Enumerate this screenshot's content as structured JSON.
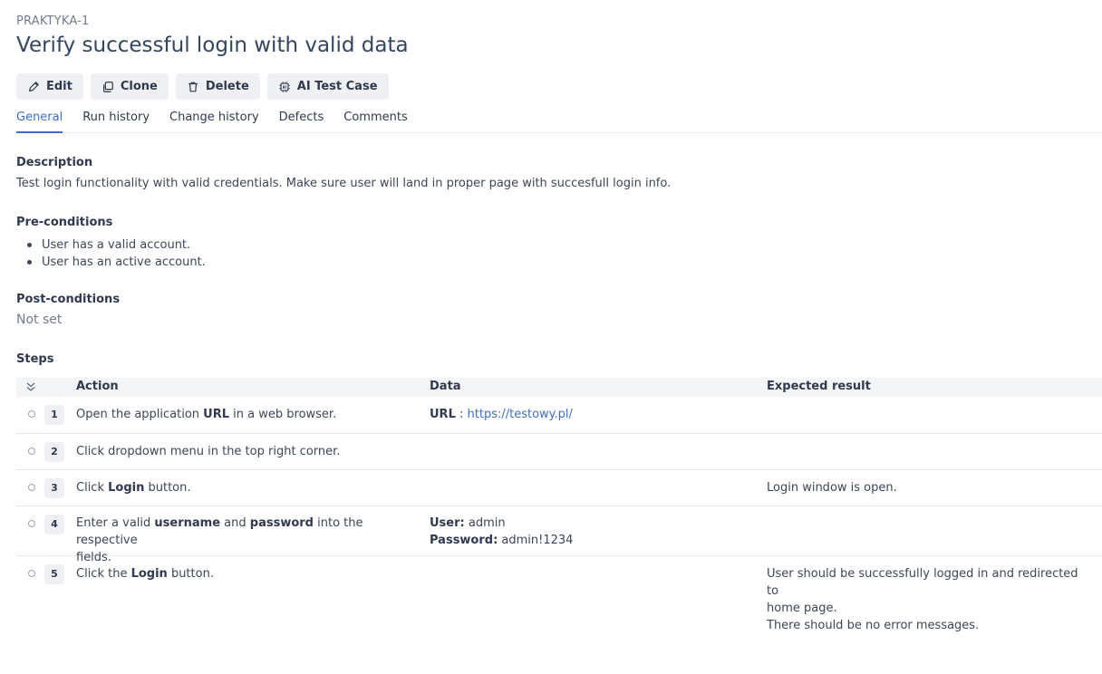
{
  "issue_key": "PRAKTYKA-1",
  "title": "Verify successful login with valid data",
  "toolbar": {
    "edit": "Edit",
    "clone": "Clone",
    "delete": "Delete",
    "ai": "AI Test Case"
  },
  "tabs": [
    "General",
    "Run history",
    "Change history",
    "Defects",
    "Comments"
  ],
  "active_tab": "General",
  "description": {
    "label": "Description",
    "text": "Test login functionality with valid credentials. Make sure user will land in proper page with succesfull login info."
  },
  "preconditions": {
    "label": "Pre-conditions",
    "items": [
      "User has a valid account.",
      "User has an active account."
    ]
  },
  "postconditions": {
    "label": "Post-conditions",
    "value": "Not set"
  },
  "steps": {
    "label": "Steps",
    "columns": {
      "action": "Action",
      "data": "Data",
      "expected": "Expected result"
    },
    "rows": [
      {
        "num": "1",
        "action_pre": "Open the application ",
        "action_bold": "URL",
        "action_post": " in a web browser.",
        "data_key": "URL",
        "data_sep": " : ",
        "data_link": "https://testowy.pl/"
      },
      {
        "num": "2",
        "action": "Click dropdown menu in the top right corner."
      },
      {
        "num": "3",
        "action_pre": "Click ",
        "action_bold": "Login",
        "action_post": " button.",
        "expected": "Login window is open."
      },
      {
        "num": "4",
        "action_pre": "Enter a valid ",
        "action_bold": "username",
        "action_mid": " and ",
        "action_bold2": "password",
        "action_post": " into the respective",
        "action_line2": "fields.",
        "data_user_key": "User:",
        "data_user_val": " admin",
        "data_pass_key": "Password:",
        "data_pass_val": " admin!1234"
      },
      {
        "num": "5",
        "action_pre": "Click the ",
        "action_bold": "Login",
        "action_post": " button.",
        "expected_l1": "User should be successfully logged in and redirected to",
        "expected_l2": "home page.",
        "expected_l3": "There should be no error messages."
      }
    ]
  }
}
